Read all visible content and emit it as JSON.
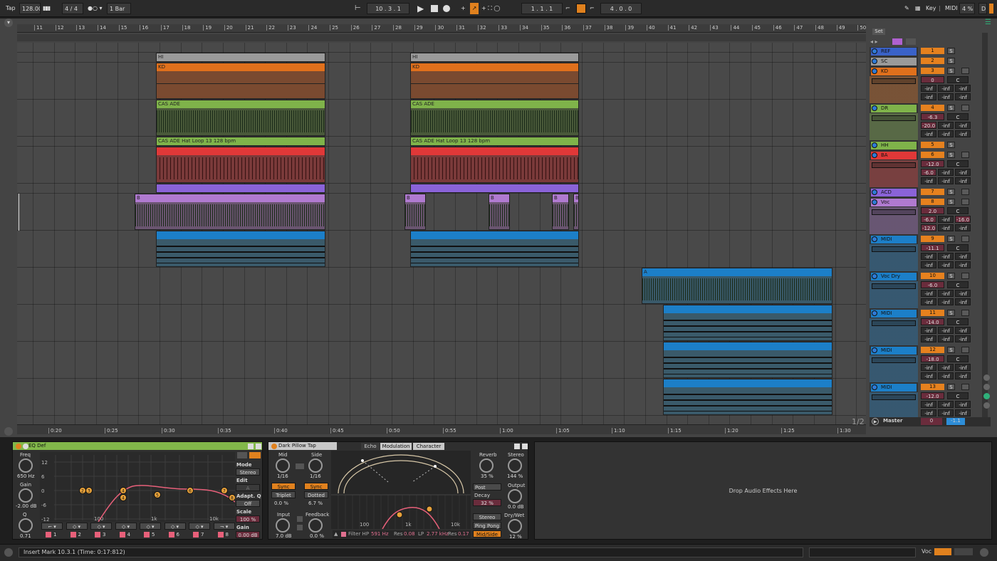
{
  "transport": {
    "tap": "Tap",
    "tempo": "128.00",
    "signature": "4 / 4",
    "quantize": "1 Bar",
    "position": "10 .  3 .  1",
    "loop_start": "1 .  1 .  1",
    "loop_length": "4 .  0 .  0",
    "key": "Key",
    "midi": "MIDI",
    "cpu": "4 %",
    "disk": "D"
  },
  "ruler": {
    "bars": [
      "11",
      "12",
      "13",
      "14",
      "15",
      "16",
      "17",
      "18",
      "19",
      "20",
      "21",
      "22",
      "23",
      "24",
      "25",
      "26",
      "27",
      "28",
      "29",
      "30",
      "31",
      "32",
      "33",
      "34",
      "35",
      "36",
      "37",
      "38",
      "39",
      "40",
      "41",
      "42",
      "43",
      "44",
      "45",
      "46",
      "47",
      "48",
      "49",
      "50"
    ],
    "times": [
      "0:20",
      "0:25",
      "0:30",
      "0:35",
      "0:40",
      "0:45",
      "0:50",
      "0:55",
      "1:00",
      "1:05",
      "1:10",
      "1:15",
      "1:20",
      "1:25",
      "1:30"
    ],
    "page": "1/2"
  },
  "set_label": "Set",
  "tracks": [
    {
      "name": "REF",
      "color": "#3a62c8",
      "num": "1",
      "vol": "",
      "pan": "",
      "meters": []
    },
    {
      "name": "SC",
      "color": "#9a9a9a",
      "num": "2",
      "vol": "",
      "pan": "",
      "meters": []
    },
    {
      "name": "KD",
      "color": "#e0701c",
      "num": "3",
      "vol": "0",
      "pan": "C",
      "meters": [
        "-inf",
        "-inf",
        "-inf",
        "-inf",
        "-inf",
        "-inf"
      ]
    },
    {
      "name": "DR",
      "color": "#7fb34a",
      "num": "4",
      "vol": "-6.3",
      "pan": "C",
      "meters": [
        "-20.0",
        "-inf",
        "-inf",
        "-inf",
        "-inf",
        "-inf"
      ]
    },
    {
      "name": "HH",
      "color": "#7fb34a",
      "num": "5",
      "vol": "",
      "pan": "",
      "meters": []
    },
    {
      "name": "BA",
      "color": "#e03838",
      "num": "6",
      "vol": "-12.0",
      "pan": "C",
      "meters": [
        "-6.0",
        "-inf",
        "-inf",
        "-inf",
        "-inf",
        "-inf"
      ]
    },
    {
      "name": "ACD",
      "color": "#8a63d8",
      "num": "7",
      "vol": "",
      "pan": "",
      "meters": []
    },
    {
      "name": "Voc",
      "color": "#b07ad0",
      "num": "8",
      "vol": "2.0",
      "pan": "C",
      "meters": [
        "-6.0",
        "-inf",
        "-16.0",
        "-12.0",
        "-inf",
        "-inf"
      ]
    },
    {
      "name": "MIDI",
      "color": "#1c7fc8",
      "num": "9",
      "vol": "-11.1",
      "pan": "C",
      "meters": [
        "-inf",
        "-inf",
        "-inf",
        "-inf",
        "-inf",
        "-inf"
      ]
    },
    {
      "name": "Voc Dry",
      "color": "#1c7fc8",
      "num": "10",
      "vol": "-6.0",
      "pan": "C",
      "meters": [
        "-inf",
        "-inf",
        "-inf",
        "-inf",
        "-inf",
        "-inf"
      ]
    },
    {
      "name": "MIDI",
      "color": "#1c7fc8",
      "num": "11",
      "vol": "-14.0",
      "pan": "C",
      "meters": [
        "-inf",
        "-inf",
        "-inf",
        "-inf",
        "-inf",
        "-inf"
      ]
    },
    {
      "name": "MIDI",
      "color": "#1c7fc8",
      "num": "12",
      "vol": "-18.0",
      "pan": "C",
      "meters": [
        "-inf",
        "-inf",
        "-inf",
        "-inf",
        "-inf",
        "-inf"
      ]
    },
    {
      "name": "MIDI",
      "color": "#1c7fc8",
      "num": "13",
      "vol": "-12.0",
      "pan": "C",
      "meters": [
        "-inf",
        "-inf",
        "-inf",
        "-inf",
        "-inf",
        "-inf"
      ]
    }
  ],
  "clips": {
    "hi": "HI",
    "kd": "KD",
    "cas": "CAS ADE",
    "hh": "CAS ADE Hat Loop 13 128 bpm",
    "b": "B",
    "a": "A"
  },
  "master": {
    "name": "Master",
    "vol": "0",
    "meter": "-1.1"
  },
  "eq": {
    "title": "EQ Def",
    "freq_label": "Freq",
    "freq": "650 Hz",
    "gain_label": "Gain",
    "gain": "-2.00 dB",
    "q_label": "Q",
    "q": "0.71",
    "db_ticks": [
      "12",
      "6",
      "0",
      "-6",
      "-12"
    ],
    "freq_ticks": [
      "100",
      "1k",
      "10k"
    ],
    "bands": [
      "1",
      "2",
      "3",
      "4",
      "5",
      "6",
      "7",
      "8"
    ],
    "mode_label": "Mode",
    "mode": "Stereo",
    "edit_label": "Edit",
    "edit": "A",
    "adapt_label": "Adapt. Q",
    "adapt": "Off",
    "scale_label": "Scale",
    "scale": "100 %",
    "gain2_label": "Gain",
    "gain2": "0.00 dB"
  },
  "echo": {
    "title": "Dark Pillow Tap",
    "tabs": [
      "Echo",
      "Modulation",
      "Character"
    ],
    "mid_label": "Mid",
    "mid": "1/16",
    "side_label": "Side",
    "side": "1/16",
    "sync": "Sync",
    "triplet": "Triplet",
    "dotted": "Dotted",
    "offset_l": "0.0 %",
    "offset_r": "6.7 %",
    "input_label": "Input",
    "input": "7.0 dB",
    "feedback_label": "Feedback",
    "feedback": "0.0 %",
    "filter": "Filter HP",
    "hp": "591 Hz",
    "res_l": "Res",
    "res1": "0.08",
    "lp_l": "LP",
    "lp": "2.77 kHz",
    "res2": "0.17",
    "freq_ticks": [
      "100",
      "1k",
      "10k"
    ],
    "reverb_label": "Reverb",
    "reverb": "35 %",
    "stereo_label": "Stereo",
    "stereo": "144 %",
    "post": "Post",
    "output_label": "Output",
    "output": "0.0 dB",
    "decay_label": "Decay",
    "decay": "32 %",
    "stereo_btn": "Stereo",
    "pingpong": "Ping Pong",
    "midside": "Mid/Side",
    "drywet_label": "Dry/Wet",
    "drywet": "12 %"
  },
  "drop_text": "Drop Audio Effects Here",
  "status": {
    "text": "Insert Mark 10.3.1 (Time: 0:17:812)",
    "track": "Voc"
  }
}
